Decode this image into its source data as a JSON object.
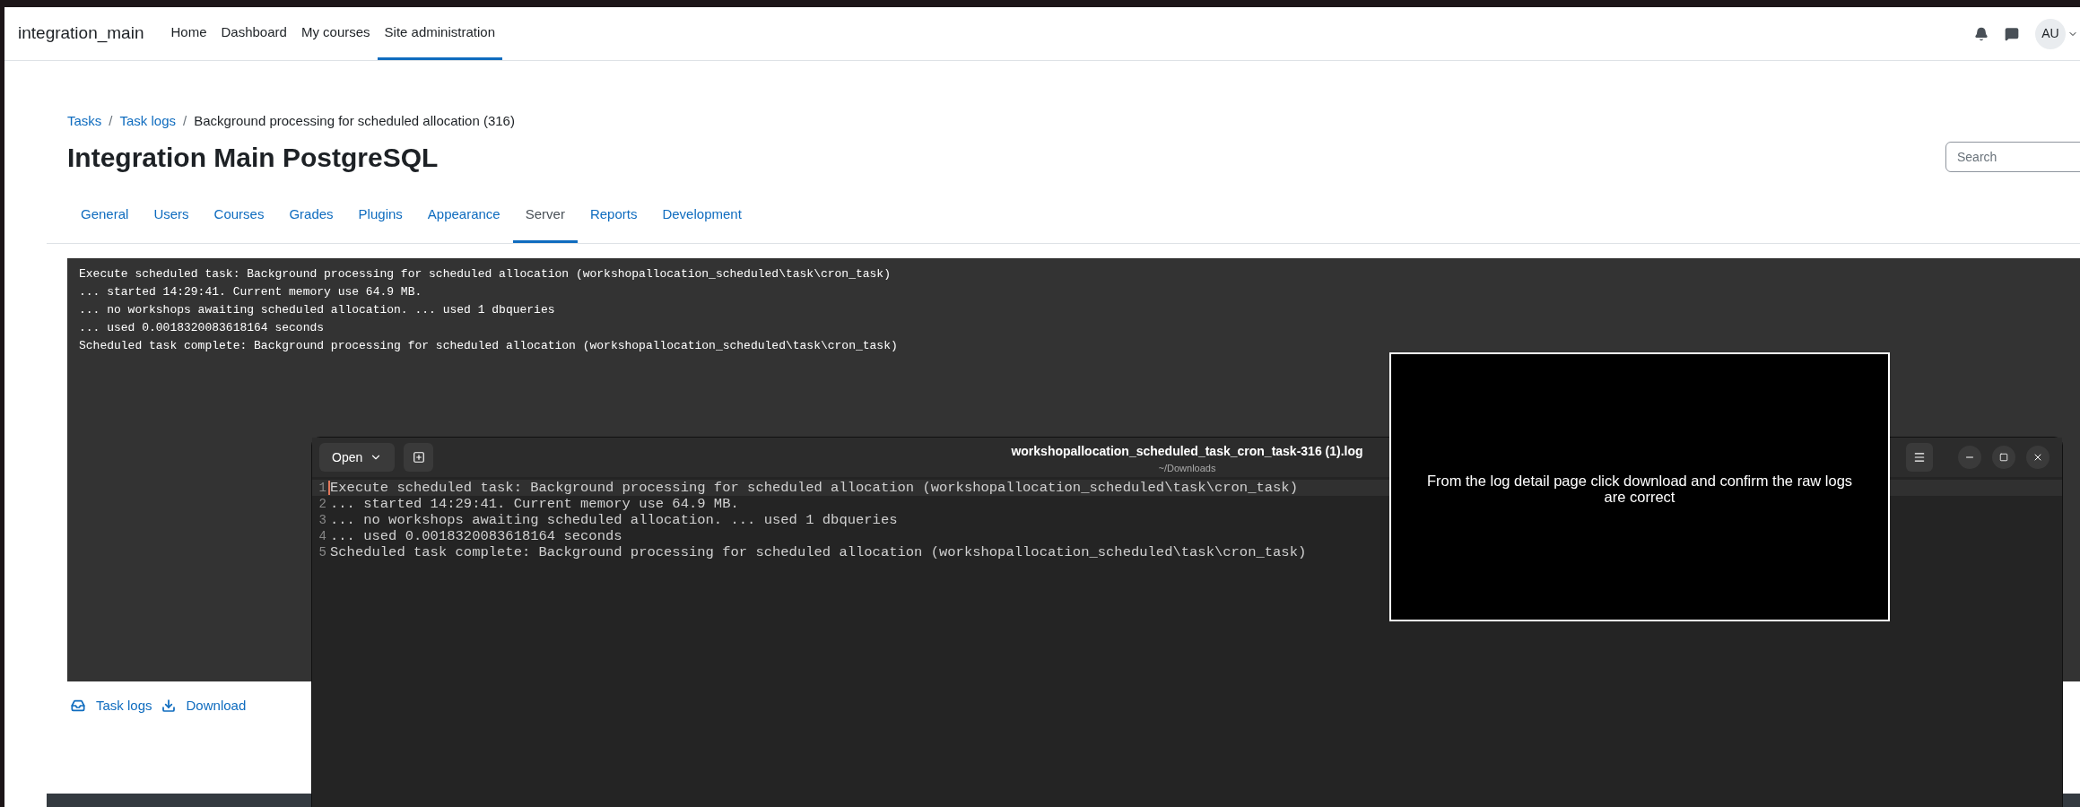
{
  "navbar": {
    "brand": "integration_main",
    "items": [
      {
        "label": "Home",
        "selected": false
      },
      {
        "label": "Dashboard",
        "selected": false
      },
      {
        "label": "My courses",
        "selected": false
      },
      {
        "label": "Site administration",
        "selected": true
      }
    ],
    "avatar": "AU"
  },
  "breadcrumb": {
    "links": [
      "Tasks",
      "Task logs"
    ],
    "separator": "/",
    "current": "Background processing for scheduled allocation (316)"
  },
  "title": "Integration Main PostgreSQL",
  "search": {
    "placeholder": "Search"
  },
  "tabs": [
    {
      "label": "General",
      "selected": false
    },
    {
      "label": "Users",
      "selected": false
    },
    {
      "label": "Courses",
      "selected": false
    },
    {
      "label": "Grades",
      "selected": false
    },
    {
      "label": "Plugins",
      "selected": false
    },
    {
      "label": "Appearance",
      "selected": false
    },
    {
      "label": "Server",
      "selected": true
    },
    {
      "label": "Reports",
      "selected": false
    },
    {
      "label": "Development",
      "selected": false
    }
  ],
  "log_lines": [
    "Execute scheduled task: Background processing for scheduled allocation (workshopallocation_scheduled\\task\\cron_task)",
    "... started 14:29:41. Current memory use 64.9 MB.",
    "... no workshops awaiting scheduled allocation. ... used 1 dbqueries",
    "... used 0.0018320083618164 seconds",
    "Scheduled task complete: Background processing for scheduled allocation (workshopallocation_scheduled\\task\\cron_task)"
  ],
  "footer_links": [
    {
      "kind": "task-logs",
      "label": "Task logs"
    },
    {
      "kind": "download",
      "label": "Download"
    }
  ],
  "editor": {
    "open_button": "Open",
    "title": "workshopallocation_scheduled_task_cron_task-316 (1).log",
    "subtitle": "~/Downloads",
    "lines": [
      {
        "number": "1",
        "text": "Execute scheduled task: Background processing for scheduled allocation (workshopallocation_scheduled\\task\\cron_task)",
        "current": true
      },
      {
        "number": "2",
        "text": "... started 14:29:41. Current memory use 64.9 MB.",
        "current": false
      },
      {
        "number": "3",
        "text": "... no workshops awaiting scheduled allocation. ... used 1 dbqueries",
        "current": false
      },
      {
        "number": "4",
        "text": "... used 0.0018320083618164 seconds",
        "current": false
      },
      {
        "number": "5",
        "text": "Scheduled task complete: Background processing for scheduled allocation (workshopallocation_scheduled\\task\\cron_task)",
        "current": false
      }
    ]
  },
  "caption": "From the log detail page click download and confirm the raw logs are correct"
}
